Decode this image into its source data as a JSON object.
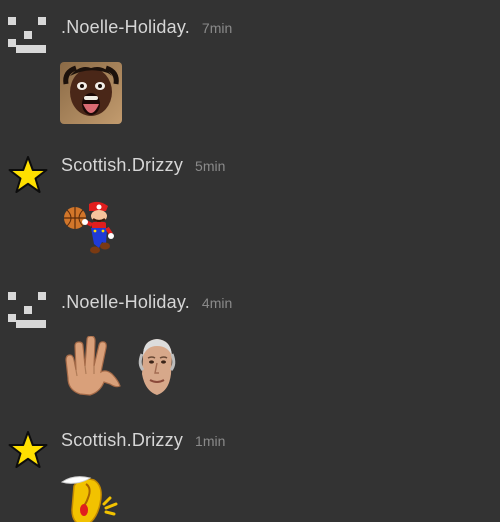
{
  "messages": [
    {
      "username": ".Noelle-Holiday.",
      "time": "7min",
      "avatar": "pixel-face-icon",
      "stickers": [
        "shocked-face-sticker"
      ]
    },
    {
      "username": "Scottish.Drizzy",
      "time": "5min",
      "avatar": "star-icon",
      "stickers": [
        "mario-basketball-sticker"
      ]
    },
    {
      "username": ".Noelle-Holiday.",
      "time": "4min",
      "avatar": "pixel-face-icon",
      "stickers": [
        "waving-hand-sticker",
        "face-cutout-sticker"
      ]
    },
    {
      "username": "Scottish.Drizzy",
      "time": "1min",
      "avatar": "star-icon",
      "stickers": [
        "yellow-cartoon-sticker"
      ]
    }
  ],
  "colors": {
    "background": "#333333",
    "username": "#d6d6d6",
    "time": "#8a8a8a",
    "star": "#ffe000"
  }
}
